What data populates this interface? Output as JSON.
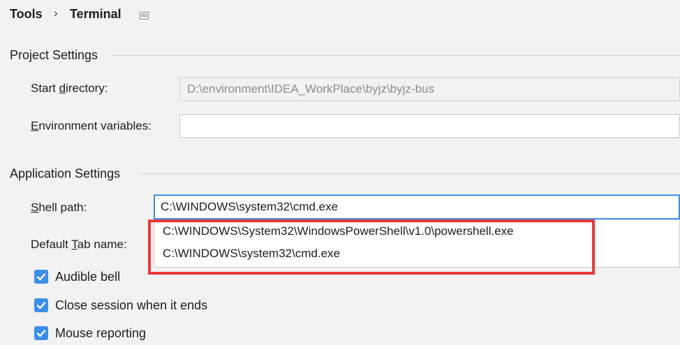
{
  "breadcrumb": {
    "parent": "Tools",
    "separator": "›",
    "current": "Terminal"
  },
  "project_settings": {
    "header": "Project Settings",
    "start_directory": {
      "label_before": "Start ",
      "label_mnemonic": "d",
      "label_after": "irectory:",
      "value": "D:\\environment\\IDEA_WorkPlace\\byjz\\byjz-bus"
    },
    "environment_variables": {
      "label_before": "",
      "label_mnemonic": "E",
      "label_after": "nvironment variables:",
      "value": ""
    }
  },
  "application_settings": {
    "header": "Application Settings",
    "shell_path": {
      "label_before": "",
      "label_mnemonic": "S",
      "label_after": "hell path:",
      "value": "C:\\WINDOWS\\system32\\cmd.exe",
      "options": [
        "C:\\WINDOWS\\System32\\WindowsPowerShell\\v1.0\\powershell.exe",
        "C:\\WINDOWS\\system32\\cmd.exe"
      ]
    },
    "default_tab_name": {
      "label_before": "Default ",
      "label_mnemonic": "T",
      "label_after": "ab name:"
    },
    "checkboxes": [
      {
        "label": "Audible bell",
        "checked": true
      },
      {
        "label": "Close session when it ends",
        "checked": true
      },
      {
        "label": "Mouse reporting",
        "checked": true
      }
    ]
  },
  "colors": {
    "accent": "#3d8ee8",
    "highlight": "#e8393b",
    "background": "#f2f2f2"
  },
  "icons": {
    "layout": "layout-icon",
    "checkbox": "checkmark-icon"
  }
}
